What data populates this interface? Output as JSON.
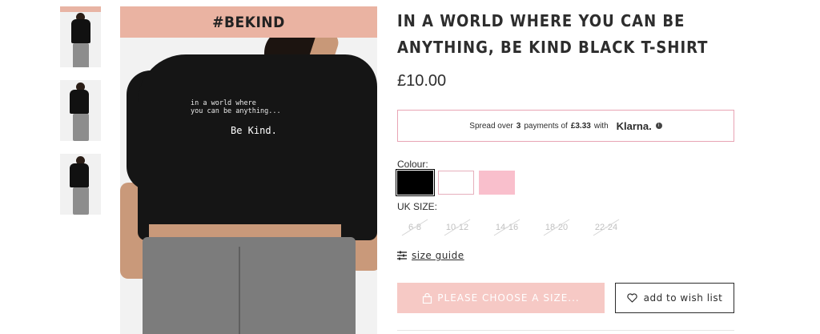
{
  "gallery": {
    "main_banner": "#BEKIND",
    "tee_print_small": "in a world where\nyou can be anything...",
    "tee_print_large": "Be Kind."
  },
  "product": {
    "title": "IN A WORLD WHERE YOU CAN BE ANYTHING, BE KIND BLACK T-SHIRT",
    "price": "£10.00"
  },
  "klarna": {
    "prefix": "Spread over",
    "count": "3",
    "middle": "payments of",
    "amount": "£3.33",
    "suffix": "with",
    "logo": "Klarna."
  },
  "colour": {
    "label": "Colour:",
    "swatches": [
      "#000000",
      "#ffffff",
      "#f9bfcc"
    ]
  },
  "sizes": {
    "label": "UK SIZE:",
    "options": [
      "6-8",
      "10-12",
      "14-16",
      "18-20",
      "22-24"
    ]
  },
  "size_guide": {
    "label": "size guide"
  },
  "buttons": {
    "choose_size": "PLEASE CHOOSE A SIZE...",
    "wishlist": "add to wish list"
  },
  "colors": {
    "accent_pink": "#f6c9c5",
    "klarna_border": "#e8a4b4",
    "text": "#2d2d2d"
  }
}
